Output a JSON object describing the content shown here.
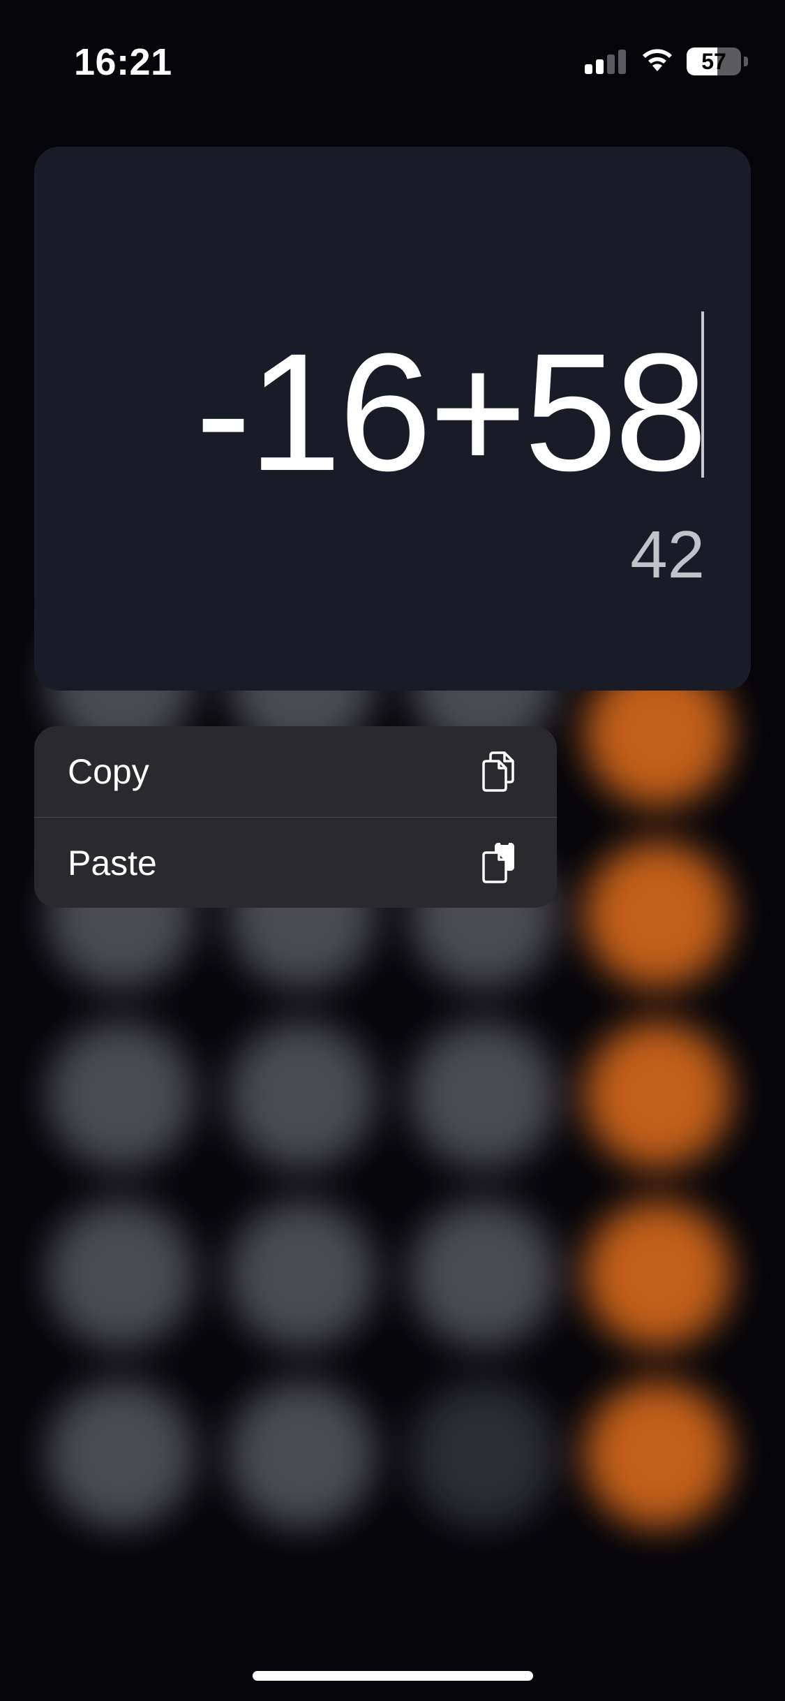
{
  "status_bar": {
    "time": "16:21",
    "battery_level": "57",
    "battery_fraction": 0.57
  },
  "display": {
    "expression": "-16+58",
    "result": "42"
  },
  "context_menu": {
    "items": [
      {
        "label": "Copy",
        "icon": "copy-icon"
      },
      {
        "label": "Paste",
        "icon": "paste-icon"
      }
    ]
  },
  "colors": {
    "display_background": "#191c26",
    "menu_background": "#2a2a2e",
    "operator_key": "#c25f1a",
    "digit_key": "#4a4a52"
  }
}
